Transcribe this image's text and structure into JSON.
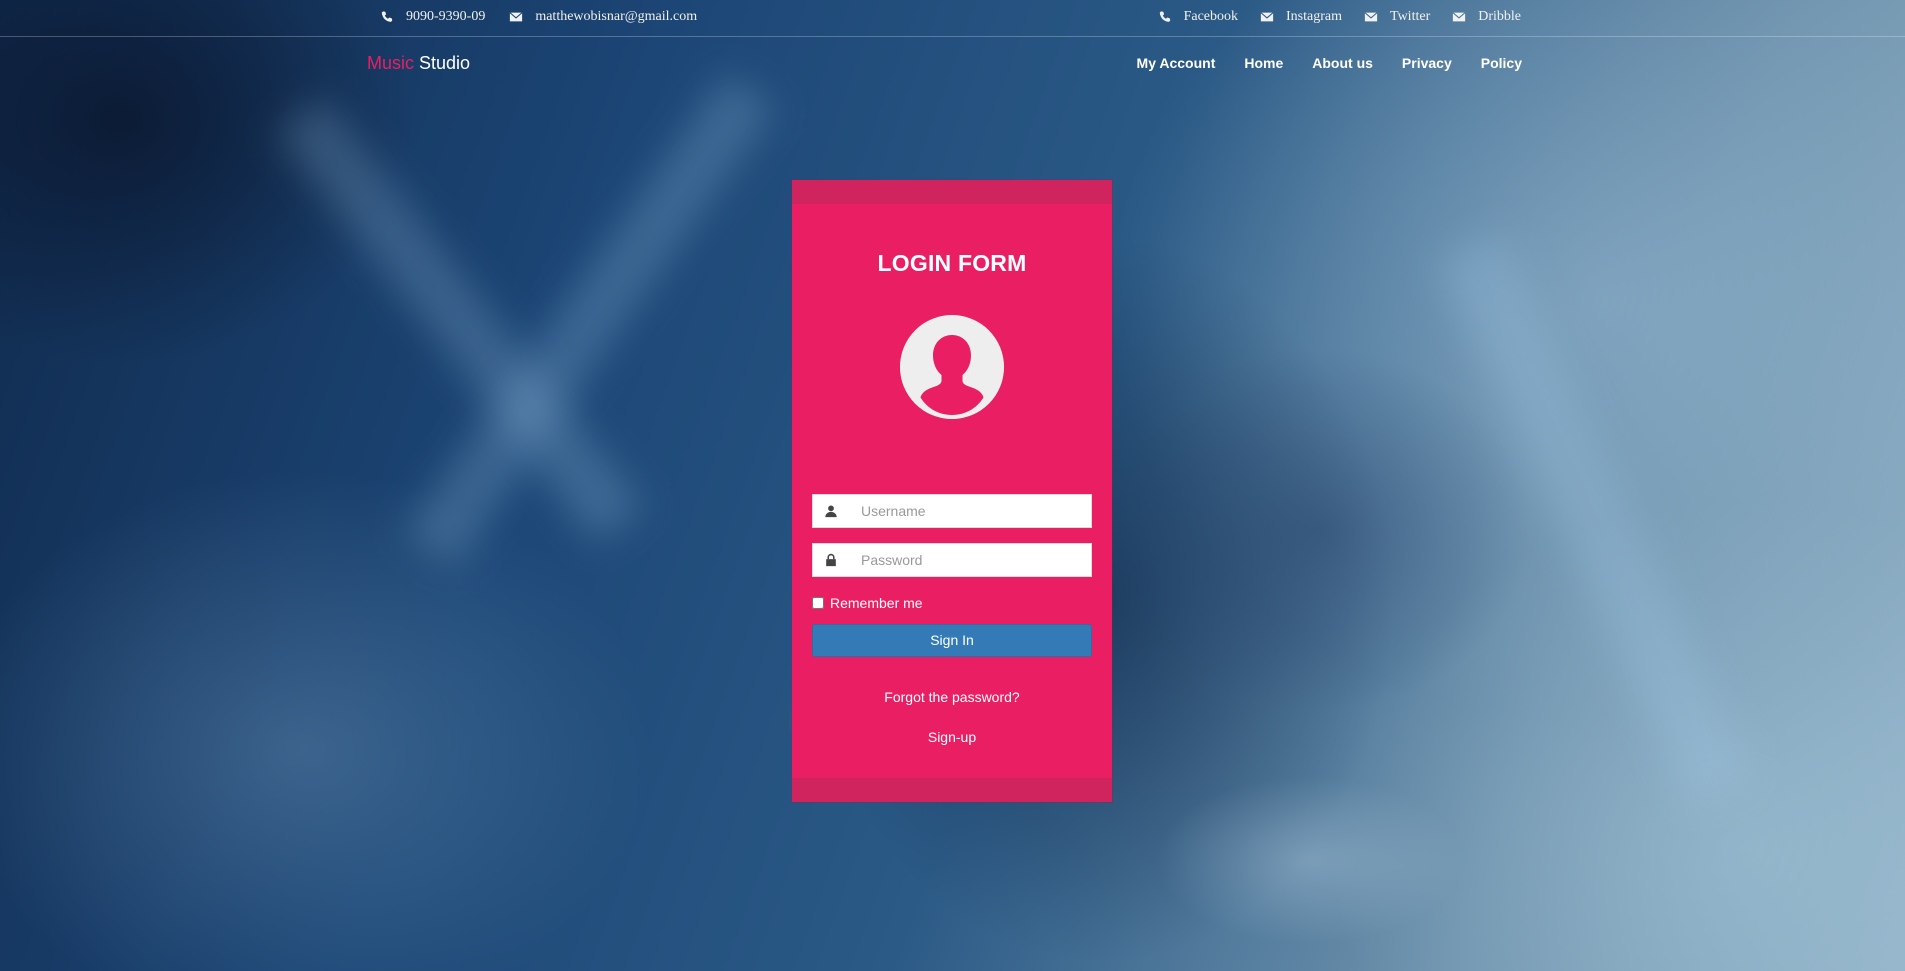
{
  "topbar": {
    "phone": "9090-9390-09",
    "email": "matthewobisnar@gmail.com",
    "social": [
      {
        "label": "Facebook",
        "icon": "phone-icon"
      },
      {
        "label": "Instagram",
        "icon": "envelope-icon"
      },
      {
        "label": "Twitter",
        "icon": "envelope-icon"
      },
      {
        "label": "Dribble",
        "icon": "envelope-icon"
      }
    ]
  },
  "brand": {
    "first": "Music",
    "second": "Studio"
  },
  "nav": [
    "My Account",
    "Home",
    "About us",
    "Privacy",
    "Policy"
  ],
  "login": {
    "title": "LOGIN FORM",
    "username_placeholder": "Username",
    "password_placeholder": "Password",
    "remember_label": "Remember me",
    "sign_in_label": "Sign In",
    "forgot_label": "Forgot the password?",
    "signup_label": "Sign-up"
  },
  "colors": {
    "accent": "#e91e63",
    "button": "#337ab7"
  }
}
